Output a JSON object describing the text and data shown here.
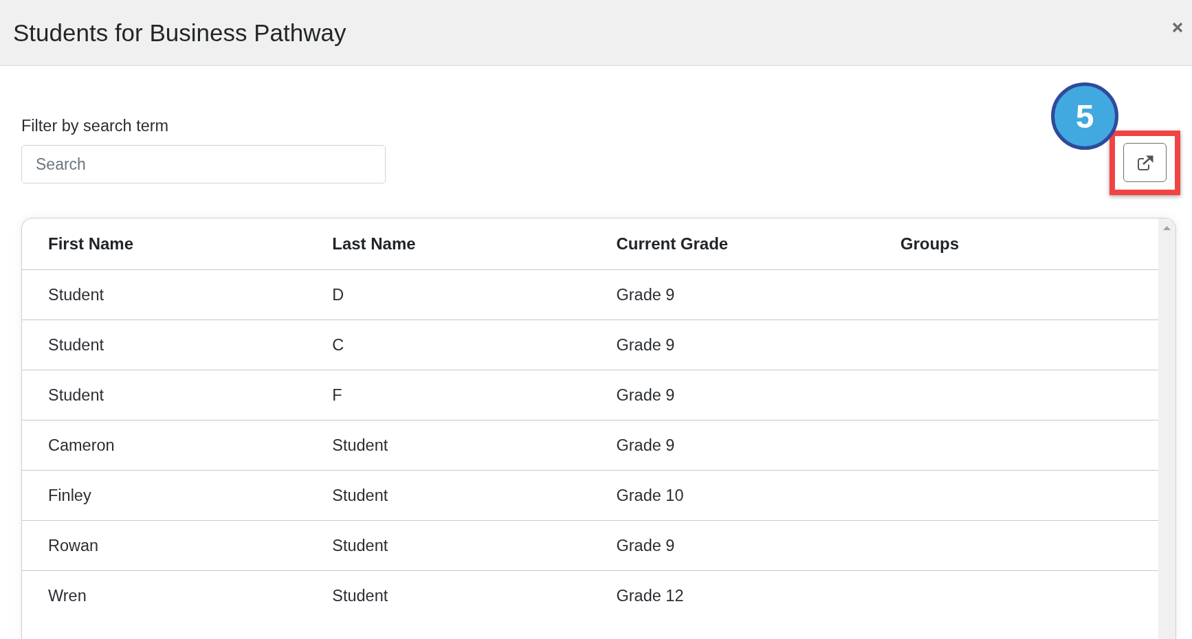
{
  "dialog": {
    "title": "Students for Business Pathway"
  },
  "filter": {
    "label": "Filter by search term",
    "placeholder": "Search"
  },
  "callout": {
    "number": "5"
  },
  "table": {
    "columns": [
      "First Name",
      "Last Name",
      "Current Grade",
      "Groups"
    ],
    "rows": [
      {
        "first_name": "Student",
        "last_name": "D",
        "current_grade": "Grade 9"
      },
      {
        "first_name": "Student",
        "last_name": "C",
        "current_grade": "Grade 9"
      },
      {
        "first_name": "Student",
        "last_name": "F",
        "current_grade": "Grade 9"
      },
      {
        "first_name": "Cameron",
        "last_name": "Student",
        "current_grade": "Grade 9"
      },
      {
        "first_name": "Finley",
        "last_name": "Student",
        "current_grade": "Grade 10"
      },
      {
        "first_name": "Rowan",
        "last_name": "Student",
        "current_grade": "Grade 9"
      },
      {
        "first_name": "Wren",
        "last_name": "Student",
        "current_grade": "Grade 12"
      }
    ]
  }
}
